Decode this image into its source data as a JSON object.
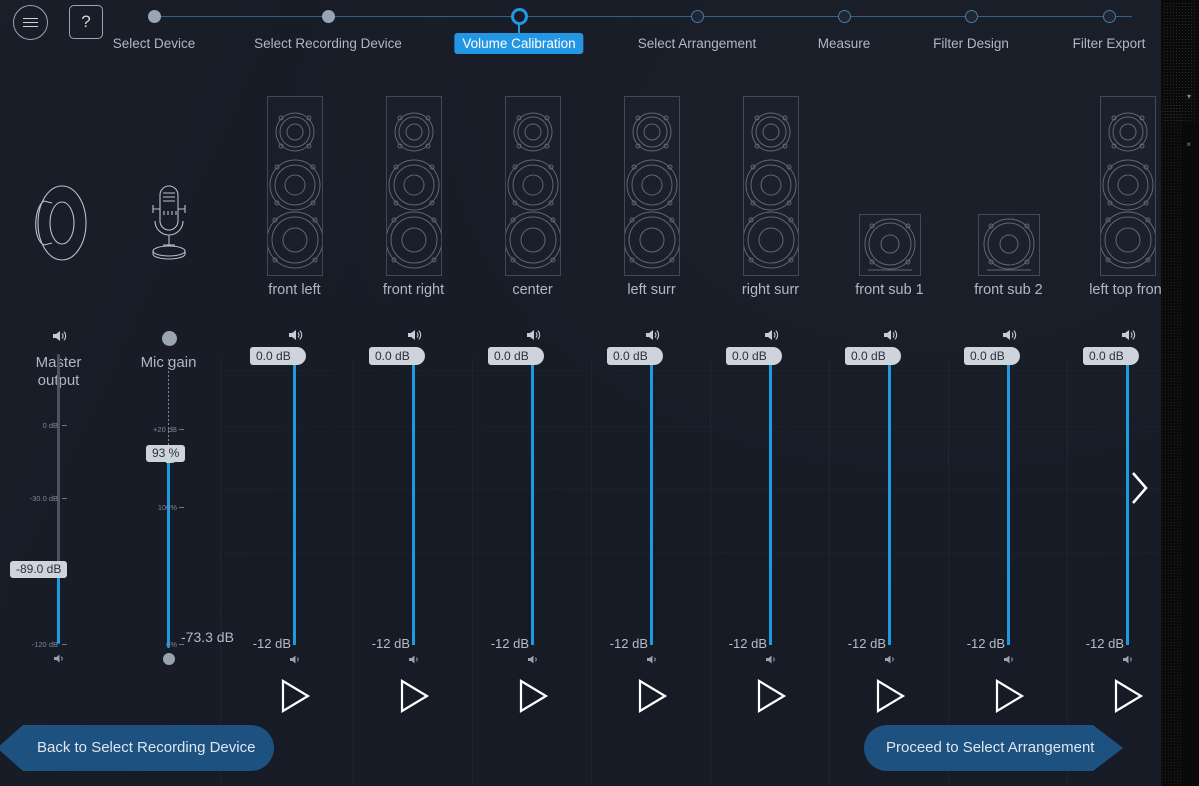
{
  "app": {
    "accent": "#2196e3",
    "slider_blue": "#1e9ae0",
    "panel_bg": "#161b26",
    "button_blue": "#1c5180"
  },
  "topbar": {
    "menu_icon": "hamburger-icon",
    "help_label": "?"
  },
  "stepper": {
    "steps": [
      {
        "label": "Select Device",
        "state": "done"
      },
      {
        "label": "Select Recording Device",
        "state": "done"
      },
      {
        "label": "Volume Calibration",
        "state": "current"
      },
      {
        "label": "Select Arrangement",
        "state": "todo"
      },
      {
        "label": "Measure",
        "state": "todo"
      },
      {
        "label": "Filter Design",
        "state": "todo"
      },
      {
        "label": "Filter Export",
        "state": "todo"
      }
    ]
  },
  "master": {
    "icon": "speaker-driver-icon",
    "label_line1": "Master",
    "label_line2": "output",
    "volume_icon": "volume-high-icon",
    "mute_icon": "volume-low-icon",
    "tick_top": "0 dB",
    "tick_mid": "-30.0 dB",
    "tick_bottom": "-120 dB",
    "value": "-89.0 dB"
  },
  "mic": {
    "icon": "microphone-icon",
    "label": "Mic gain",
    "top_knob_icon": "knob-icon",
    "bottom_knob_icon": "knob-icon",
    "tick_top": "+20 dB",
    "tick_mid": "100%",
    "tick_bottom": "0%",
    "value": "93 %",
    "readout": "-73.3 dB"
  },
  "channels": [
    {
      "name": "front left",
      "type": "tower",
      "value": "0.0 dB",
      "min": "-12 dB",
      "play_icon": "play-icon",
      "volume_icon": "volume-high-icon",
      "mute_icon": "volume-low-icon"
    },
    {
      "name": "front right",
      "type": "tower",
      "value": "0.0 dB",
      "min": "-12 dB",
      "play_icon": "play-icon",
      "volume_icon": "volume-high-icon",
      "mute_icon": "volume-low-icon"
    },
    {
      "name": "center",
      "type": "tower",
      "value": "0.0 dB",
      "min": "-12 dB",
      "play_icon": "play-icon",
      "volume_icon": "volume-high-icon",
      "mute_icon": "volume-low-icon"
    },
    {
      "name": "left surr",
      "type": "tower",
      "value": "0.0 dB",
      "min": "-12 dB",
      "play_icon": "play-icon",
      "volume_icon": "volume-high-icon",
      "mute_icon": "volume-low-icon"
    },
    {
      "name": "right surr",
      "type": "tower",
      "value": "0.0 dB",
      "min": "-12 dB",
      "play_icon": "play-icon",
      "volume_icon": "volume-high-icon",
      "mute_icon": "volume-low-icon"
    },
    {
      "name": "front sub 1",
      "type": "sub",
      "value": "0.0 dB",
      "min": "-12 dB",
      "play_icon": "play-icon",
      "volume_icon": "volume-high-icon",
      "mute_icon": "volume-low-icon"
    },
    {
      "name": "front sub 2",
      "type": "sub",
      "value": "0.0 dB",
      "min": "-12 dB",
      "play_icon": "play-icon",
      "volume_icon": "volume-high-icon",
      "mute_icon": "volume-low-icon"
    },
    {
      "name": "left top front",
      "type": "tower",
      "value": "0.0 dB",
      "min": "-12 dB",
      "play_icon": "play-icon",
      "volume_icon": "volume-high-icon",
      "mute_icon": "volume-low-icon"
    }
  ],
  "scroll": {
    "next_icon": "chevron-right-icon"
  },
  "nav": {
    "back_label": "Back to Select Recording Device",
    "forward_label": "Proceed to Select Arrangement"
  }
}
